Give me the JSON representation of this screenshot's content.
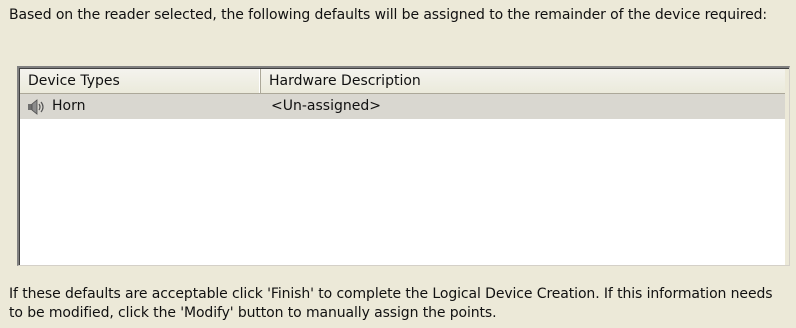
{
  "intro_text": "Based on the reader selected, the following defaults will be assigned to the remainder of the device required:",
  "list": {
    "columns": {
      "device_types": "Device Types",
      "hardware_description": "Hardware Description"
    },
    "rows": [
      {
        "device_type": "Horn",
        "hardware_description": "<Un-assigned>",
        "icon": "speaker-horn-icon"
      }
    ]
  },
  "footer_text": "If these defaults are acceptable click  'Finish' to complete the Logical Device Creation. If this information needs to be modified, click the 'Modify' button to manually assign the points.",
  "colors": {
    "dialog_background": "#ece9d8",
    "selected_row": "#d9d7d0",
    "list_background": "#ffffff"
  }
}
